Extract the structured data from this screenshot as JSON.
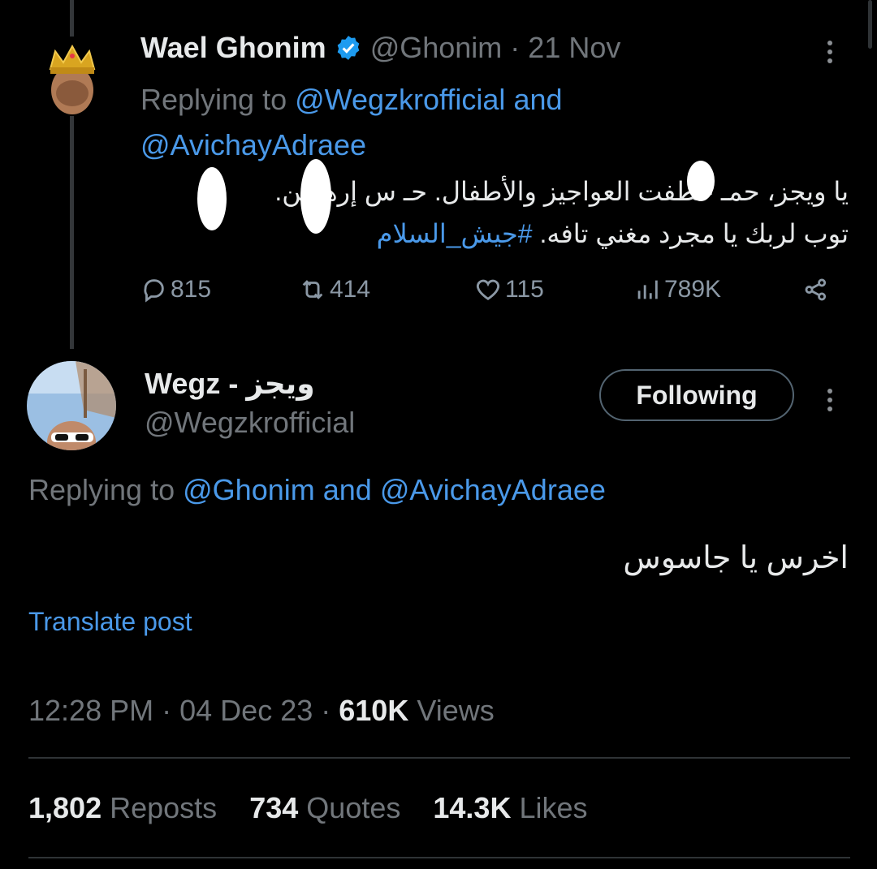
{
  "tweet1": {
    "author_name": "Wael Ghonim",
    "handle": "@Ghonim",
    "separator": "·",
    "date": "21 Nov",
    "replying_prefix": "Replying to",
    "replying_mention1": "@Wegzkrofficial",
    "replying_and": "and",
    "replying_mention2": "@AvichayAdraee",
    "text_line1": "يا ويجز، حمـ   خطفت العواجيز والأطفال. حـ   س إرهـ   ين.",
    "text_line2": "توب لربك يا مجرد مغني تافه.",
    "hashtag": "#جيش_السلام",
    "replies": "815",
    "reposts": "414",
    "likes": "115",
    "views": "789K"
  },
  "tweet2": {
    "author_name": "Wegz - ويجز",
    "handle": "@Wegzkrofficial",
    "follow_label": "Following",
    "replying_prefix": "Replying to",
    "replying_mention1": "@Ghonim",
    "replying_and": "and",
    "replying_mention2": "@AvichayAdraee",
    "text": "اخرس يا جاسوس",
    "translate_label": "Translate post",
    "time": "12:28 PM",
    "sep": "·",
    "date": "04 Dec 23",
    "views_count": "610K",
    "views_label": "Views",
    "reposts_count": "1,802",
    "reposts_label": "Reposts",
    "quotes_count": "734",
    "quotes_label": "Quotes",
    "likes_count": "14.3K",
    "likes_label": "Likes"
  },
  "colors": {
    "background": "#000000",
    "text": "#e7e9ea",
    "secondary": "#71767b",
    "link": "#1d9bf0",
    "verified": "#1d9bf0"
  },
  "icons": [
    "verified-badge-icon",
    "more-icon",
    "reply-icon",
    "repost-icon",
    "like-icon",
    "views-icon",
    "share-icon"
  ]
}
